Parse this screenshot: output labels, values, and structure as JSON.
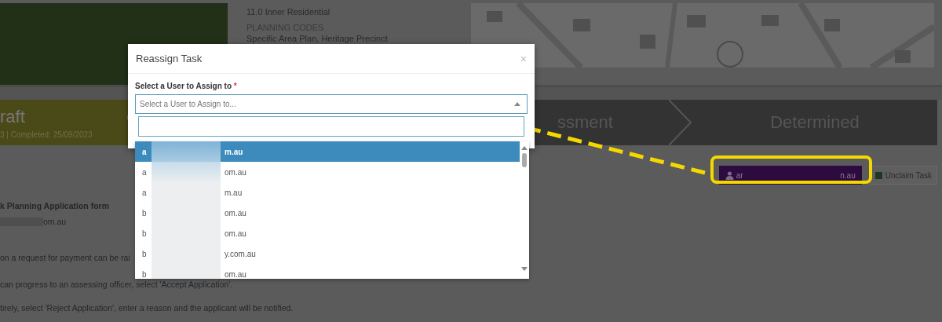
{
  "property": {
    "zone": "11.0 Inner Residential",
    "codes_label": "PLANNING CODES",
    "codes": "Specific Area Plan, Heritage Precinct"
  },
  "stages": [
    {
      "name": "raft",
      "dates": "3 | Completed: 25/09/2023",
      "kind": "done"
    },
    {
      "name": "ssment",
      "kind": "pending"
    },
    {
      "name": "Determined",
      "kind": "pending"
    }
  ],
  "assignee": {
    "start": "ar",
    "end": "n.au"
  },
  "unclaim": {
    "label": "Unclaim Task",
    "checked": true
  },
  "content": {
    "heading": "k Planning Application form",
    "email_end": "om.au",
    "lines": [
      "on a request for payment can be rai",
      "can progress to an assessing officer, select 'Accept Application'.",
      "tirely, select 'Reject Application', enter a reason and the applicant will be notified."
    ]
  },
  "modal": {
    "title": "Reassign Task",
    "close": "×",
    "field_label": "Select a User to Assign to",
    "required": "*",
    "placeholder": "Select a User to Assign to...",
    "options": [
      {
        "start": "a",
        "end": "m.au",
        "selected": true
      },
      {
        "start": "a",
        "end": "om.au",
        "selected": false
      },
      {
        "start": "a",
        "end": "m.au",
        "selected": false
      },
      {
        "start": "b",
        "end": "om.au",
        "selected": false
      },
      {
        "start": "b",
        "end": "om.au",
        "selected": false
      },
      {
        "start": "b",
        "end": "y.com.au",
        "selected": false
      },
      {
        "start": "b",
        "end": "om.au",
        "selected": false
      }
    ]
  }
}
